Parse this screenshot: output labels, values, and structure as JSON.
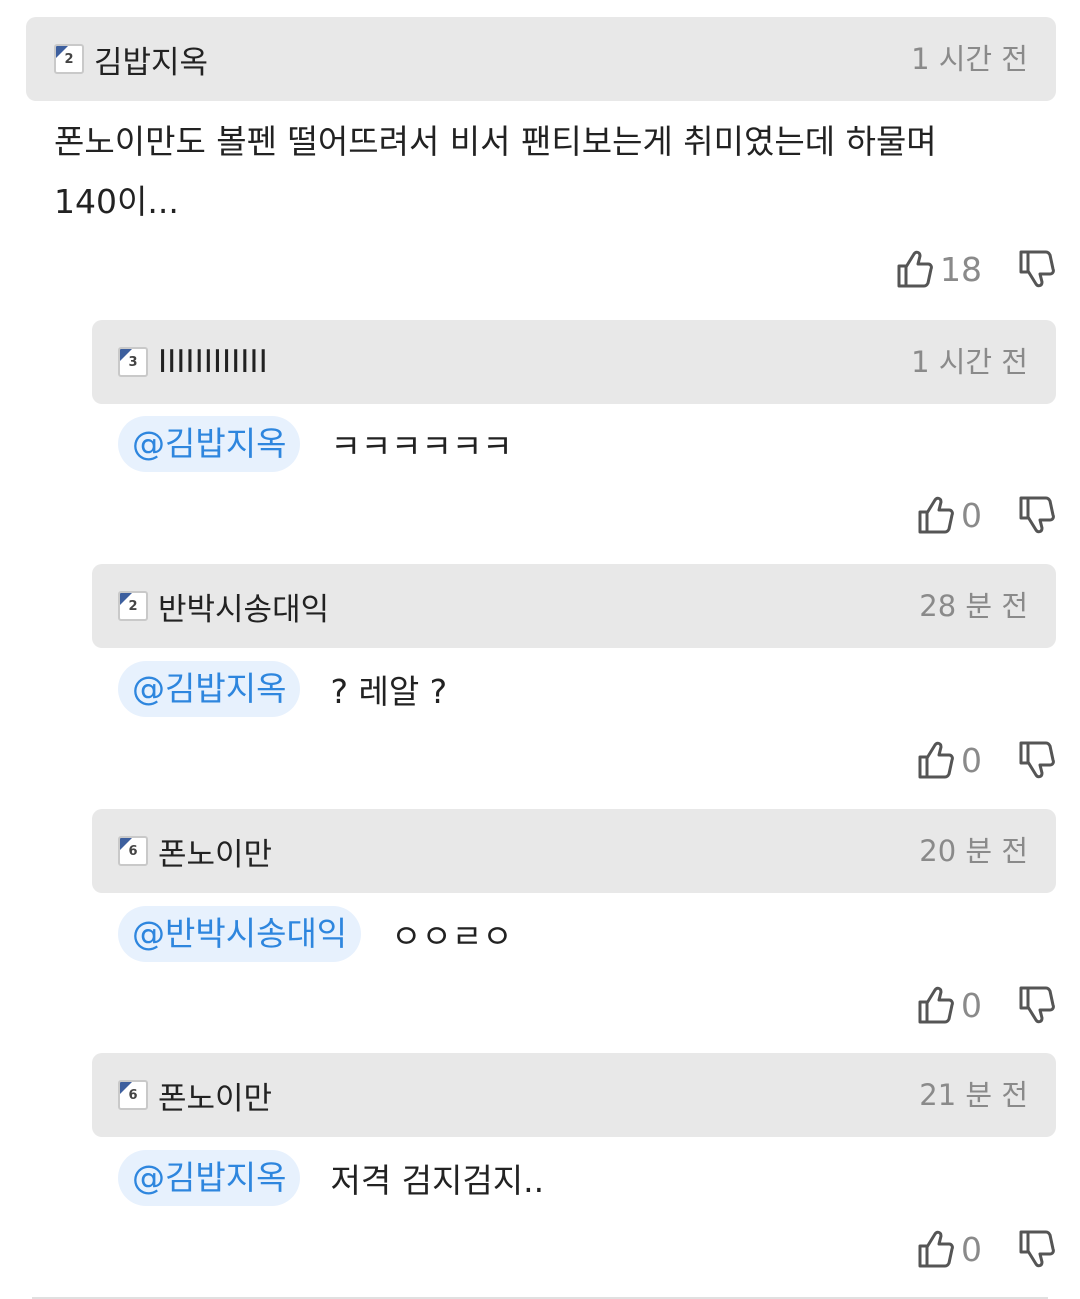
{
  "comments": [
    {
      "author": "김밥지옥",
      "level": "2",
      "time": "1 시간 전",
      "text": "폰노이만도 볼펜 떨어뜨려서 비서 팬티보는게 취미였는데 하물며\n140이...",
      "likes": "18"
    },
    {
      "author": "IIIIIIIIIIII",
      "level": "3",
      "time": "1 시간 전",
      "mention": "@김밥지옥",
      "text": "ㅋㅋㅋㅋㅋㅋ",
      "likes": "0"
    },
    {
      "author": "반박시송대익",
      "level": "2",
      "time": "28 분 전",
      "mention": "@김밥지옥",
      "text": "? 레알 ?",
      "likes": "0"
    },
    {
      "author": "폰노이만",
      "level": "6",
      "time": "20 분 전",
      "mention": "@반박시송대익",
      "text": "ㅇㅇㄹㅇ",
      "likes": "0"
    },
    {
      "author": "폰노이만",
      "level": "6",
      "time": "21 분 전",
      "mention": "@김밥지옥",
      "text": "저격 검지검지..",
      "likes": "0"
    }
  ]
}
